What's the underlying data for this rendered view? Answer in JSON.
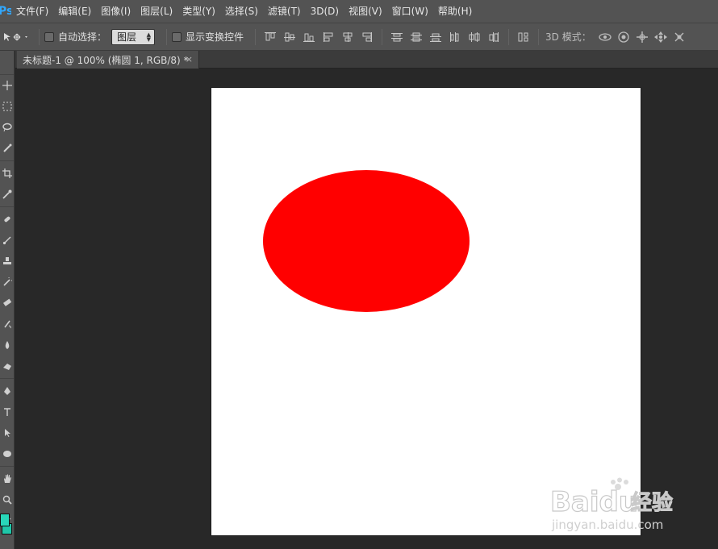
{
  "app": {
    "logo_text": "Ps"
  },
  "menu": [
    {
      "label": "文件(F)"
    },
    {
      "label": "编辑(E)"
    },
    {
      "label": "图像(I)"
    },
    {
      "label": "图层(L)"
    },
    {
      "label": "类型(Y)"
    },
    {
      "label": "选择(S)"
    },
    {
      "label": "滤镜(T)"
    },
    {
      "label": "3D(D)"
    },
    {
      "label": "视图(V)"
    },
    {
      "label": "窗口(W)"
    },
    {
      "label": "帮助(H)"
    }
  ],
  "options": {
    "tool_icon": "move-tool-icon",
    "auto_select_label": "自动选择：",
    "auto_select_checked": false,
    "auto_select_target": "图层",
    "show_transform_label": "显示变换控件",
    "show_transform_checked": false,
    "mode_3d_label": "3D 模式："
  },
  "document": {
    "tab_title": "未标题-1 @ 100% (椭圆 1, RGB/8) *",
    "close_glyph": "×",
    "background_color": "#ffffff",
    "ellipse_color": "#ff0000"
  },
  "toolbox": {
    "foreground_color": "#29d7b9",
    "background_color": "#1fc6a8"
  },
  "watermark": {
    "brand": "Baidu",
    "brand_cn": "经验",
    "url": "jingyan.baidu.com"
  }
}
